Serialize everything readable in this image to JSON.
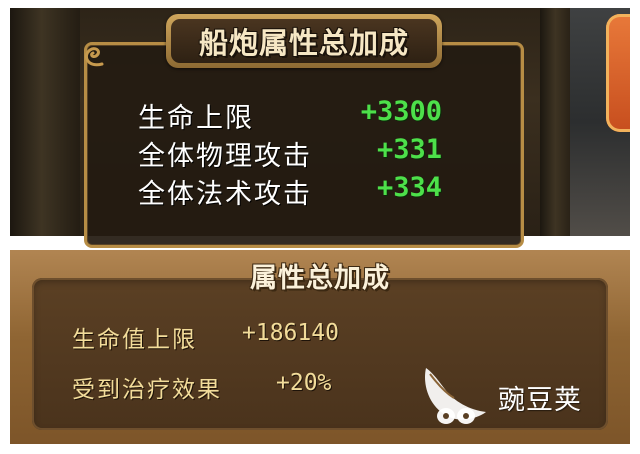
{
  "cannon_panel": {
    "title": "船炮属性总加成",
    "stats": [
      {
        "label": "生命上限",
        "value": "+3300"
      },
      {
        "label": "全体物理攻击",
        "value": "+331"
      },
      {
        "label": "全体法术攻击",
        "value": "+334"
      }
    ]
  },
  "total_panel": {
    "title": "属性总加成",
    "stats": [
      {
        "label": "生命值上限",
        "value": "+186140"
      },
      {
        "label": "受到治疗效果",
        "value": "+20%"
      }
    ]
  },
  "watermark": {
    "text": "豌豆荚"
  },
  "colors": {
    "positive_value": "#4de04a",
    "label_white": "#ffffff",
    "label_gold": "#f2dc9a",
    "frame_gold": "#b78d45"
  }
}
